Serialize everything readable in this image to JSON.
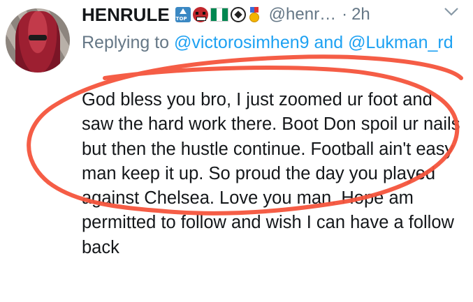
{
  "tweet": {
    "author_name": "HENRULE",
    "author_handle": "@henr…",
    "separator": "·",
    "timestamp": "2h",
    "emojis": [
      "top-arrow-icon",
      "ogre-icon",
      "nigeria-flag-icon",
      "soccer-ball-icon",
      "medal-icon"
    ],
    "replying_prefix": "Replying to",
    "replying_mention_1": "@victorosimhen9",
    "replying_and": "and",
    "replying_mention_2": "@Lukman_rd",
    "body": "God bless you bro, I just zoomed ur foot and saw the hard work there. Boot Don spoil ur nails but then the hustle continue. Football ain't easy man keep it up. So proud the day you played against Chelsea. Love you man. Hope am permitted to follow and wish I can have a follow back"
  },
  "colors": {
    "name": "#14171a",
    "secondary": "#657786",
    "mention": "#1da1f2",
    "annotation": "#f4543c"
  }
}
